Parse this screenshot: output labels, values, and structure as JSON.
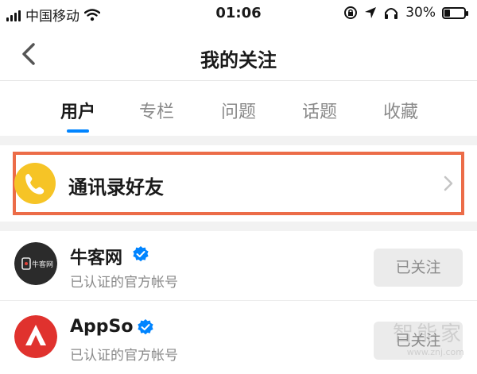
{
  "status_bar": {
    "carrier": "中国移动",
    "time": "01:06",
    "battery_text": "30%",
    "battery_level": 0.3,
    "icons": [
      "signal-icon",
      "wifi-icon",
      "screen-rotation-lock-icon",
      "location-icon",
      "headphones-icon",
      "battery-icon"
    ]
  },
  "nav": {
    "title": "我的关注",
    "back_icon": "chevron-left-icon"
  },
  "tabs": [
    {
      "label": "用户",
      "active": true
    },
    {
      "label": "专栏",
      "active": false
    },
    {
      "label": "问题",
      "active": false
    },
    {
      "label": "话题",
      "active": false
    },
    {
      "label": "收藏",
      "active": false
    }
  ],
  "contacts": {
    "label": "通讯录好友",
    "icon": "phone-icon",
    "highlight_color": "#ec6c48",
    "icon_bg": "#f6c426"
  },
  "users": [
    {
      "name": "牛客网",
      "description": "已认证的官方帐号",
      "follow_label": "已关注",
      "avatar_text": "牛客网",
      "verified": true
    },
    {
      "name": "AppSo",
      "description": "已认证的官方帐号",
      "follow_label": "已关注",
      "verified": true
    }
  ],
  "watermark": {
    "main": "智能家",
    "sub": "www.znj.com"
  },
  "colors": {
    "accent": "#0084ff",
    "verify_badge": "#0084ff",
    "appso_avatar": "#e0322e"
  }
}
